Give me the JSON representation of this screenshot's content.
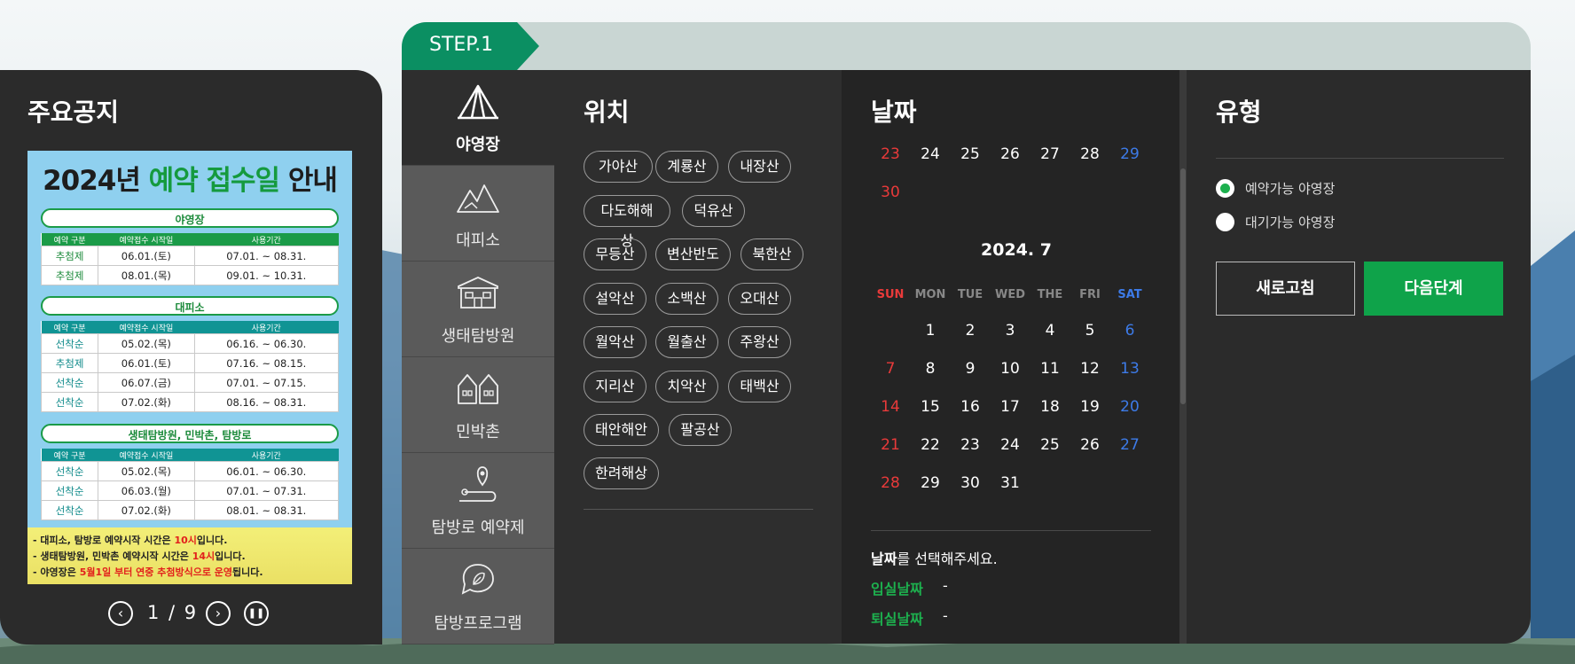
{
  "notice": {
    "title": "주요공지",
    "poster": {
      "heading_pre": "2024년 ",
      "heading_green": "예약 접수일",
      "heading_post": " 안내",
      "sections": [
        {
          "name": "야영장",
          "header": [
            "예약 구분",
            "예약접수 시작일",
            "사용기간"
          ],
          "rows": [
            [
              "추첨제",
              "06.01.(토)",
              "07.01. ~ 08.31."
            ],
            [
              "추첨제",
              "08.01.(목)",
              "09.01. ~ 10.31."
            ]
          ]
        },
        {
          "name": "대피소",
          "header": [
            "예약 구분",
            "예약접수 시작일",
            "사용기간"
          ],
          "rows": [
            [
              "선착순",
              "05.02.(목)",
              "06.16. ~ 06.30."
            ],
            [
              "추첨제",
              "06.01.(토)",
              "07.16. ~ 08.15."
            ],
            [
              "선착순",
              "06.07.(금)",
              "07.01. ~ 07.15."
            ],
            [
              "선착순",
              "07.02.(화)",
              "08.16. ~ 08.31."
            ]
          ]
        },
        {
          "name": "생태탐방원, 민박촌, 탐방로",
          "header": [
            "예약 구분",
            "예약접수 시작일",
            "사용기간"
          ],
          "rows": [
            [
              "선착순",
              "05.02.(목)",
              "06.01. ~ 06.30."
            ],
            [
              "선착순",
              "06.03.(월)",
              "07.01. ~ 07.31."
            ],
            [
              "선착순",
              "07.02.(화)",
              "08.01. ~ 08.31."
            ]
          ]
        }
      ],
      "notes": [
        {
          "pre": "- 대피소, 탐방로 예약시작 시간은 ",
          "red": "10시",
          "post": "입니다."
        },
        {
          "pre": "- 생태탐방원, 민박촌 예약시작 시간은 ",
          "red": "14시",
          "post": "입니다."
        },
        {
          "pre": "- 야영장은 ",
          "red": "5월1일 부터 연중 추첨방식으로 운영",
          "post": "됩니다."
        }
      ]
    },
    "pager": {
      "text": "1 / 9",
      "prev_icon": "chevron-left-icon",
      "next_icon": "chevron-right-icon",
      "pause_icon": "pause-icon"
    }
  },
  "step": {
    "label": "STEP.1"
  },
  "categories": [
    {
      "label": "야영장",
      "icon": "tent-icon",
      "active": true
    },
    {
      "label": "대피소",
      "icon": "mountain-icon",
      "active": false
    },
    {
      "label": "생태탐방원",
      "icon": "building-icon",
      "active": false
    },
    {
      "label": "민박촌",
      "icon": "houses-icon",
      "active": false
    },
    {
      "label": "탐방로 예약제",
      "icon": "trail-pin-icon",
      "active": false
    },
    {
      "label": "탐방프로그램",
      "icon": "leaf-hand-icon",
      "active": false
    }
  ],
  "location": {
    "title": "위치",
    "rows": [
      [
        "가야산",
        "계룡산",
        "내장산"
      ],
      [
        "다도해해상",
        "덕유산"
      ],
      [
        "무등산",
        "변산반도",
        "북한산"
      ],
      [
        "설악산",
        "소백산",
        "오대산"
      ],
      [
        "월악산",
        "월출산",
        "주왕산"
      ],
      [
        "지리산",
        "치악산",
        "태백산"
      ],
      [
        "태안해안",
        "팔공산"
      ],
      [
        "한려해상"
      ]
    ]
  },
  "date": {
    "title": "날짜",
    "prev_month_tail": [
      [
        "23",
        "24",
        "25",
        "26",
        "27",
        "28",
        "29"
      ],
      [
        "30"
      ]
    ],
    "month_title": "2024. 7",
    "weekdays": [
      "SUN",
      "MON",
      "TUE",
      "WED",
      "THE",
      "FRI",
      "SAT"
    ],
    "weeks": [
      [
        "",
        "1",
        "2",
        "3",
        "4",
        "5",
        "6"
      ],
      [
        "7",
        "8",
        "9",
        "10",
        "11",
        "12",
        "13"
      ],
      [
        "14",
        "15",
        "16",
        "17",
        "18",
        "19",
        "20"
      ],
      [
        "21",
        "22",
        "23",
        "24",
        "25",
        "26",
        "27"
      ],
      [
        "28",
        "29",
        "30",
        "31",
        "",
        "",
        ""
      ]
    ],
    "hint_bold": "날짜",
    "hint_rest": "를 선택해주세요.",
    "checkin_label": "입실날짜",
    "checkin_value": "-",
    "checkout_label": "퇴실날짜",
    "checkout_value": "-"
  },
  "type": {
    "title": "유형",
    "options": [
      {
        "label": "예약가능 야영장",
        "selected": true
      },
      {
        "label": "대기가능 야영장",
        "selected": false
      }
    ],
    "refresh_label": "새로고침",
    "next_label": "다음단계"
  },
  "colors": {
    "accent": "#0fa34a",
    "step_tab": "#0b8f62",
    "sunday": "#e93a3a",
    "saturday": "#3d7be8"
  }
}
